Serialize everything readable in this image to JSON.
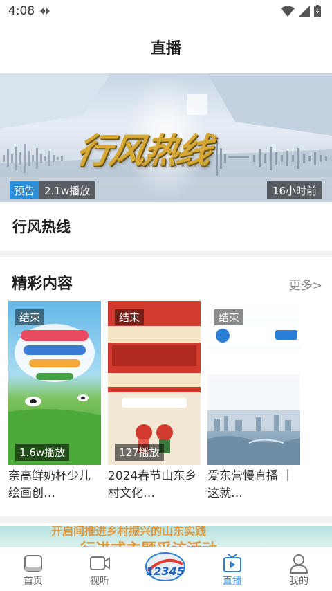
{
  "status_bar": {
    "time": "4:08"
  },
  "header": {
    "title": "直播"
  },
  "featured": {
    "banner_logo_text": "行风热线",
    "banner_subtext": "HANG FENG RE XIAN",
    "tag_label": "预告",
    "view_count": "2.1w播放",
    "time_ago": "16小时前",
    "title": "行风热线"
  },
  "section": {
    "title": "精彩内容",
    "more_label": "更多>"
  },
  "cards": [
    {
      "status": "结束",
      "count": "1.6w播放",
      "title": "奈高鲜奶杯少儿绘画创…"
    },
    {
      "status": "结束",
      "count": "127播放",
      "title": "2024春节山东乡村文化…"
    },
    {
      "status": "结束",
      "count": "",
      "title": "爱东营慢直播 ｜ 这就…"
    }
  ],
  "bottom_banner": {
    "line1": "开启间推进乡村振兴的山东实践",
    "line2": "行进式主题采访活动"
  },
  "tabbar": {
    "items": [
      {
        "label": "首页",
        "icon": "home-icon"
      },
      {
        "label": "视听",
        "icon": "video-icon"
      },
      {
        "label": "",
        "icon": "hotline-12345-logo"
      },
      {
        "label": "直播",
        "icon": "live-tv-icon"
      },
      {
        "label": "我的",
        "icon": "user-icon"
      }
    ],
    "active": "直播",
    "center_logo_text": "12345"
  },
  "colors": {
    "accent": "#2a7ed6",
    "tag_blue": "#2e8ed8",
    "banner_gold": "#d6a835"
  }
}
